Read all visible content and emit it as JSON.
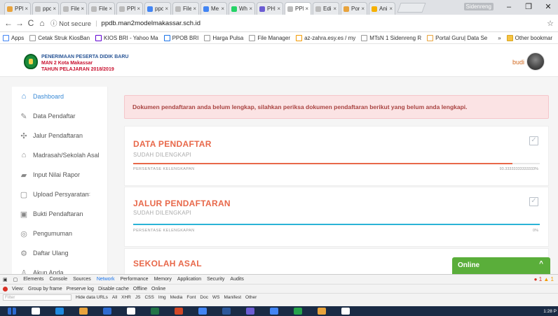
{
  "browser": {
    "tabs": [
      {
        "label": "PPI",
        "color": "#e8a33c",
        "active": false
      },
      {
        "label": "ppc",
        "color": "#bbbbbb",
        "active": false
      },
      {
        "label": "File",
        "color": "#bbbbbb",
        "active": false
      },
      {
        "label": "File",
        "color": "#bbbbbb",
        "active": false
      },
      {
        "label": "PPI",
        "color": "#bbbbbb",
        "active": false
      },
      {
        "label": "ppc",
        "color": "#4285f4",
        "active": false
      },
      {
        "label": "File",
        "color": "#bbbbbb",
        "active": false
      },
      {
        "label": "Me:",
        "color": "#4285f4",
        "active": false
      },
      {
        "label": "Wh",
        "color": "#25d366",
        "active": false
      },
      {
        "label": "PHI",
        "color": "#6c5dd3",
        "active": false
      },
      {
        "label": "PPI",
        "color": "#bbbbbb",
        "active": true
      },
      {
        "label": "Edi",
        "color": "#bbbbbb",
        "active": false
      },
      {
        "label": "Por",
        "color": "#e8a33c",
        "active": false
      },
      {
        "label": "Ani",
        "color": "#f6b100",
        "active": false
      }
    ],
    "window_user": "Sidenreng",
    "window_controls": {
      "minimize": "–",
      "maximize": "❐",
      "close": "✕"
    },
    "nav": {
      "back": "←",
      "forward": "→",
      "reload": "C",
      "home": "⌂"
    },
    "security_label": "ⓘ Not secure",
    "url": "ppdb.man2modelmakassar.sch.id",
    "star": "☆",
    "bookmarks": [
      {
        "label": "Apps",
        "color": "#4285f4"
      },
      {
        "label": "Cetak Struk KiosBan",
        "color": "#999999"
      },
      {
        "label": "KIOS BRI - Yahoo Ma",
        "color": "#6001d2"
      },
      {
        "label": "PPOB BRI",
        "color": "#1a73e8"
      },
      {
        "label": "Harga Pulsa",
        "color": "#999999"
      },
      {
        "label": "File Manager",
        "color": "#999999"
      },
      {
        "label": "az-zahra.esy.es / my",
        "color": "#f29900"
      },
      {
        "label": "MTsN 1 Sidenreng R",
        "color": "#999999"
      },
      {
        "label": "Portal Guru| Data Se",
        "color": "#e8a33c"
      }
    ],
    "bookmarks_more": "»",
    "other_bookmarks": "Other bookmar"
  },
  "site": {
    "brand_line1": "PENERIMAAN PESERTA DIDIK BARU",
    "brand_line2": "MAN 2 Kota Makassar",
    "brand_line3": "TAHUN PELAJARAN 2018/2019",
    "username": "budi"
  },
  "sidebar": {
    "items": [
      {
        "label": "Dashboard",
        "icon": "⌂",
        "active": true
      },
      {
        "label": "Data Pendaftar",
        "icon": "✎",
        "active": false
      },
      {
        "label": "Jalur Pendaftaran",
        "icon": "✣",
        "active": false
      },
      {
        "label": "Madrasah/Sekolah Asal",
        "icon": "⌂",
        "active": false
      },
      {
        "label": "Input Nilai Rapor",
        "icon": "▰",
        "active": false
      },
      {
        "label": "Upload Persyaratan",
        "icon": "▢",
        "active": false,
        "chevron": "<"
      },
      {
        "label": "Bukti Pendaftaran",
        "icon": "▣",
        "active": false
      },
      {
        "label": "Pengumuman",
        "icon": "◎",
        "active": false
      },
      {
        "label": "Daftar Ulang",
        "icon": "⚙",
        "active": false
      },
      {
        "label": "Akun Anda",
        "icon": "♙",
        "active": false
      }
    ]
  },
  "main": {
    "alert": "Dokumen pendaftaran anda belum lengkap, silahkan periksa dokumen pendaftaran berikut yang belum anda lengkapi.",
    "cards": [
      {
        "title": "DATA PENDAFTAR",
        "status": "SUDAH DILENGKAPI",
        "progress_label": "PERSENTASE KELENGKAPAN",
        "progress_value": "93.33333333333333%",
        "progress": 0.9333,
        "bar_color": "#e8684a"
      },
      {
        "title": "JALUR PENDAFTARAN",
        "status": "SUDAH DILENGKAPI",
        "progress_label": "PERSENTASE KELENGKAPAN",
        "progress_value": "0%",
        "progress": 1.0,
        "bar_color": "#2bb3d6"
      },
      {
        "title": "SEKOLAH ASAL",
        "status": "",
        "progress_label": "",
        "progress_value": "",
        "progress": 0,
        "bar_color": "#e8684a"
      }
    ],
    "check_glyph": "✓"
  },
  "chat": {
    "label": "Online",
    "toggle": "^"
  },
  "devtools": {
    "tabs": [
      "Elements",
      "Console",
      "Sources",
      "Network",
      "Performance",
      "Memory",
      "Application",
      "Security",
      "Audits"
    ],
    "selected": "Network",
    "errors": "● 1",
    "warnings": "▲ 1",
    "toolbar": [
      "View:",
      "Group by frame",
      "Preserve log",
      "Disable cache",
      "Offline",
      "Online"
    ],
    "filter_placeholder": "Filter",
    "filter_types": [
      "Hide data URLs",
      "All",
      "XHR",
      "JS",
      "CSS",
      "Img",
      "Media",
      "Font",
      "Doc",
      "WS",
      "Manifest",
      "Other"
    ]
  },
  "taskbar": {
    "apps": [
      "#2d6bd1",
      "#ffffff",
      "#1f8ae0",
      "#e8a33c",
      "#2d6bd1",
      "#ffffff",
      "#217346",
      "#d24726",
      "#4285f4",
      "#2b579a",
      "#6c5dd3",
      "#4285f4",
      "#25a24b",
      "#e8a33c",
      "#ffffff"
    ],
    "time": "1:28 P"
  }
}
